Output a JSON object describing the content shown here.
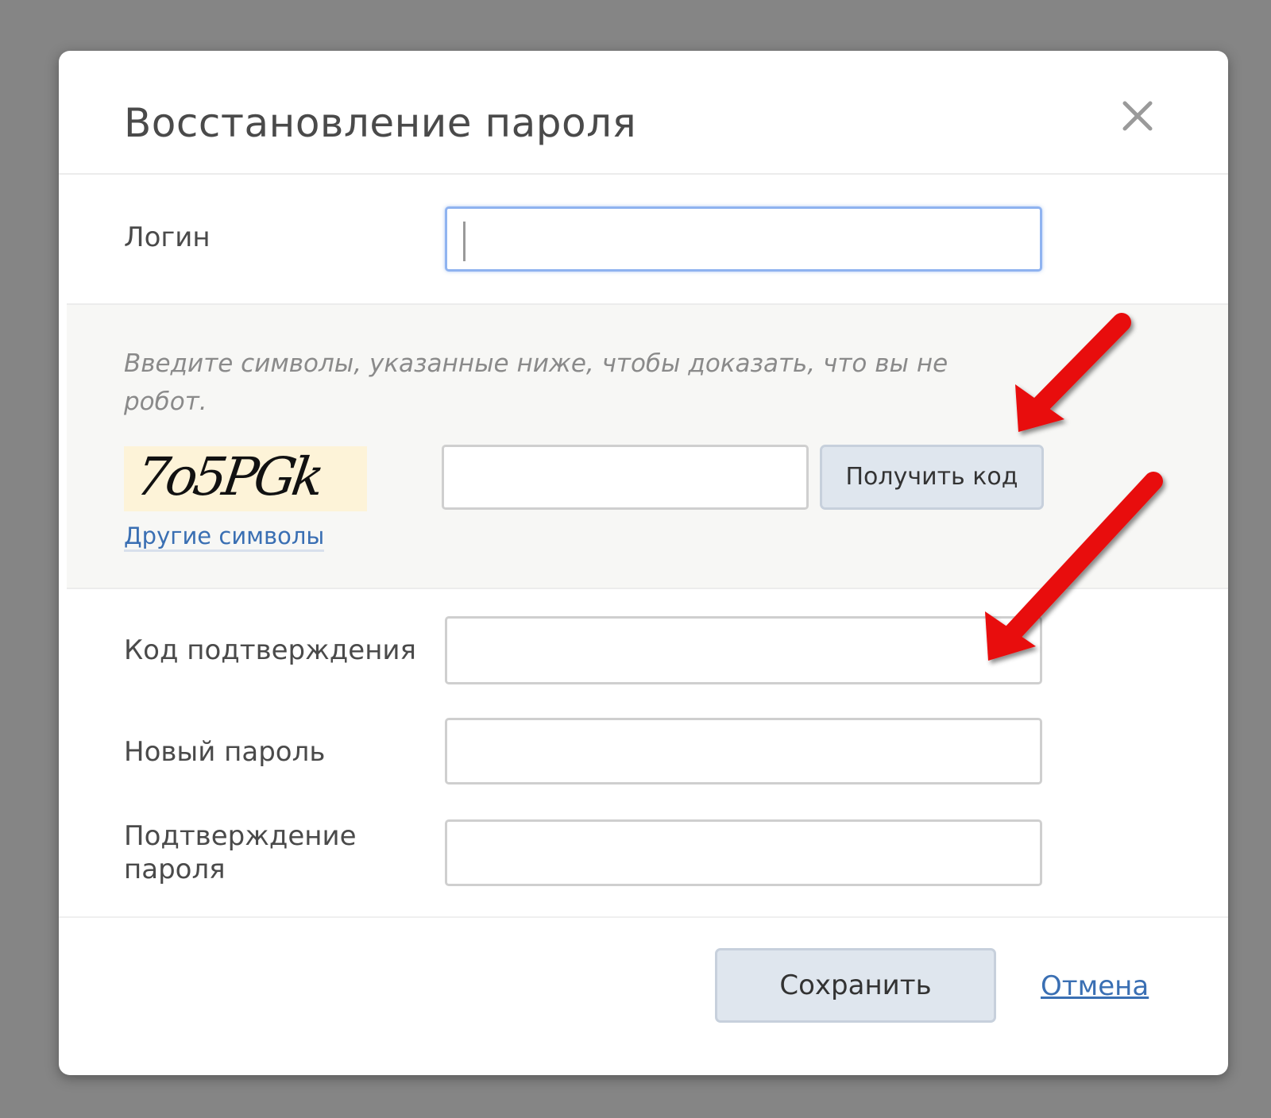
{
  "dialog": {
    "title": "Восстановление пароля"
  },
  "fields": {
    "login_label": "Логин",
    "login_value": "",
    "confirmation_code_label": "Код подтверждения",
    "new_password_label": "Новый пароль",
    "password_confirm_label_line1": "Подтверждение",
    "password_confirm_label_line2": "пароля"
  },
  "captcha": {
    "hint": "Введите символы, указанные ниже, чтобы доказать, что вы не робот.",
    "image_text": "7o5PGk",
    "other_symbols_link": "Другие символы",
    "get_code_button": "Получить код"
  },
  "footer": {
    "save_button": "Сохранить",
    "cancel_link": "Отмена"
  },
  "colors": {
    "backdrop": "#858585",
    "link": "#3a6fb3",
    "button_bg": "#dfe6ee",
    "focus_border": "#8fb3f0",
    "arrow": "#e81010"
  },
  "icons": {
    "close": "close-icon",
    "annotation_arrow": "red-arrow"
  }
}
